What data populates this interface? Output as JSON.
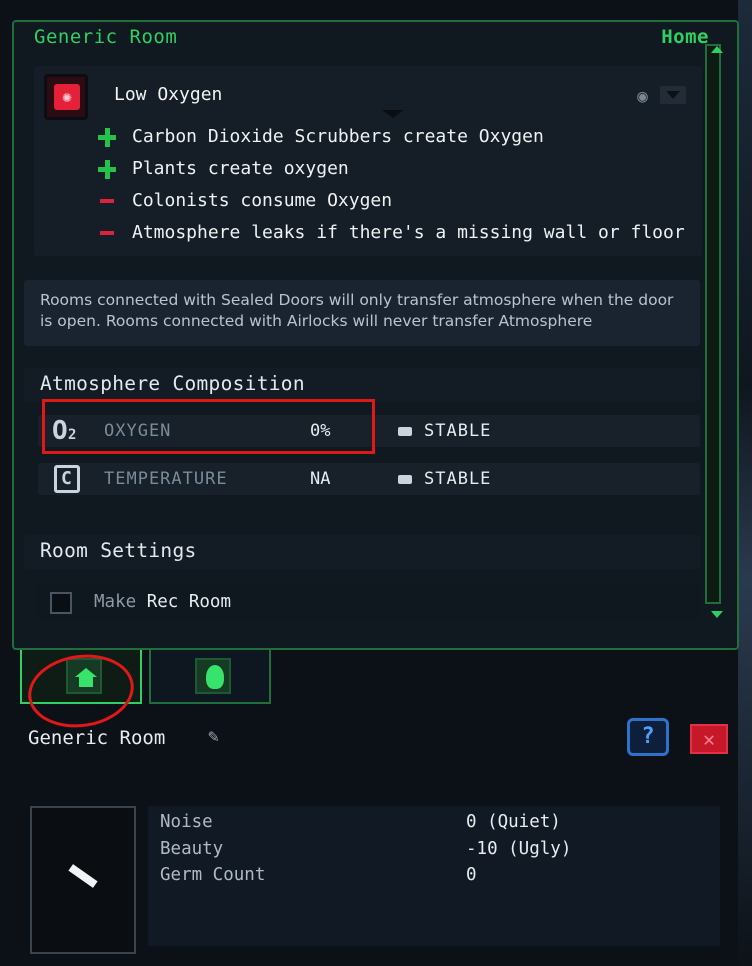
{
  "panel": {
    "title": "Generic Room",
    "home_label": "Home"
  },
  "alert": {
    "title": "Low Oxygen",
    "lines": [
      {
        "sign": "plus",
        "text": "Carbon Dioxide Scrubbers create Oxygen"
      },
      {
        "sign": "plus",
        "text": "Plants create oxygen"
      },
      {
        "sign": "minus",
        "text": "Colonists consume Oxygen"
      },
      {
        "sign": "minus",
        "text": "Atmosphere leaks if there's a missing wall or floor"
      }
    ]
  },
  "info_text": "Rooms connected with Sealed Doors will only transfer atmosphere when the door is open. Rooms connected with Airlocks will never transfer Atmosphere",
  "atmosphere": {
    "heading": "Atmosphere Composition",
    "rows": [
      {
        "icon": "o2-icon",
        "icon_text": "O₂",
        "name": "OXYGEN",
        "value": "0%",
        "status": "STABLE"
      },
      {
        "icon": "temperature-icon",
        "icon_text": "C",
        "name": "TEMPERATURE",
        "value": "NA",
        "status": "STABLE"
      }
    ]
  },
  "room_settings": {
    "heading": "Room Settings",
    "make_prefix": "Make",
    "make_room": "Rec Room"
  },
  "lower": {
    "title": "Generic Room",
    "help_label": "?",
    "close_label": "✕",
    "stats": [
      {
        "label": "Noise",
        "value": "0 (Quiet)"
      },
      {
        "label": "Beauty",
        "value": "-10 (Ugly)"
      },
      {
        "label": "Germ Count",
        "value": "0"
      }
    ]
  },
  "colors": {
    "accent_green": "#2fd063",
    "alert_red": "#e5213a",
    "annotation_red": "#e01818",
    "help_blue": "#2f73c8"
  }
}
